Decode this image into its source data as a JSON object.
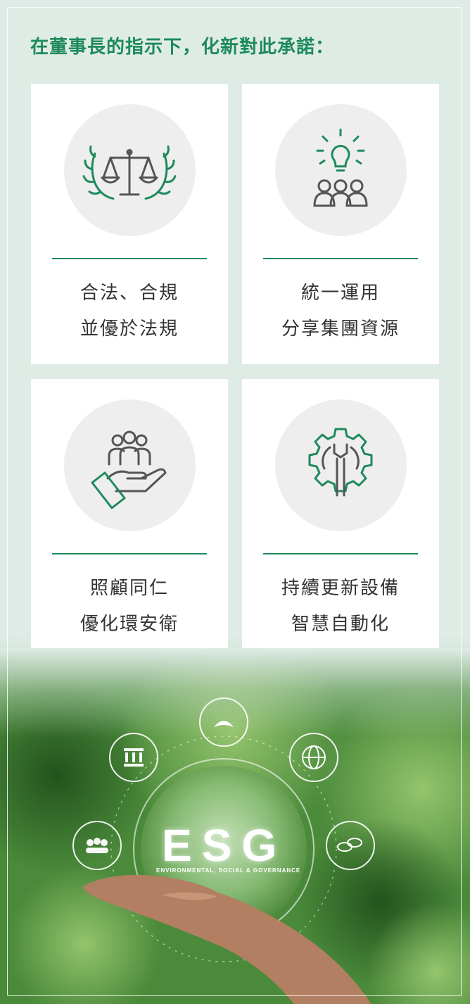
{
  "heading": "在董事長的指示下，化新對此承諾：",
  "cards": [
    {
      "icon": "scales-laurel-icon",
      "line1": "合法、合規",
      "line2": "並優於法規"
    },
    {
      "icon": "lightbulb-team-icon",
      "line1": "統一運用",
      "line2": "分享集團資源"
    },
    {
      "icon": "hand-people-care-icon",
      "line1": "照顧同仁",
      "line2": "優化環安衛"
    },
    {
      "icon": "gear-wrench-icon",
      "line1": "持續更新設備",
      "line2": "智慧自動化"
    }
  ],
  "banner": {
    "title": "ESG",
    "subtitle": "ENVIRONMENTAL, SOCIAL & GOVERNANCE"
  },
  "colors": {
    "accent": "#1e8a5c",
    "background": "#dfece6",
    "card": "#ffffff",
    "text": "#333333"
  }
}
